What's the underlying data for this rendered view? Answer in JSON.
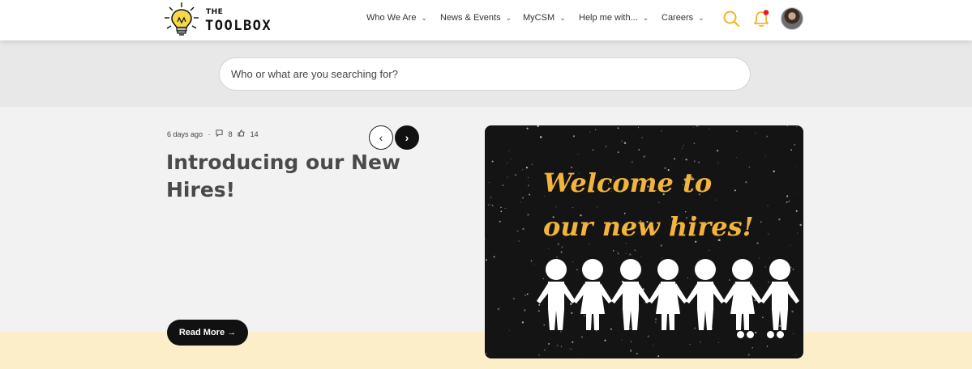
{
  "brand": {
    "line1": "THE",
    "line2": "TOOLBOX"
  },
  "nav": [
    {
      "label": "Who We Are"
    },
    {
      "label": "News & Events"
    },
    {
      "label": "MyCSM"
    },
    {
      "label": "Help me with..."
    },
    {
      "label": "Careers"
    }
  ],
  "icons": {
    "search": "search-icon",
    "notifications": "bell-icon",
    "avatar": "user-avatar"
  },
  "colors": {
    "accent": "#f0b429",
    "notification_dot": "#e11d2a",
    "bottom_band": "#fbeec9"
  },
  "search": {
    "placeholder": "Who or what are you searching for?"
  },
  "article": {
    "time": "6 days ago",
    "separator": "·",
    "comments": "8",
    "likes": "14",
    "title": "Introducing our New Hires!",
    "read_more": "Read More →",
    "image_text_line1": "Welcome to",
    "image_text_line2": "our new hires!"
  },
  "carousel": {
    "prev": "‹",
    "next": "›"
  }
}
